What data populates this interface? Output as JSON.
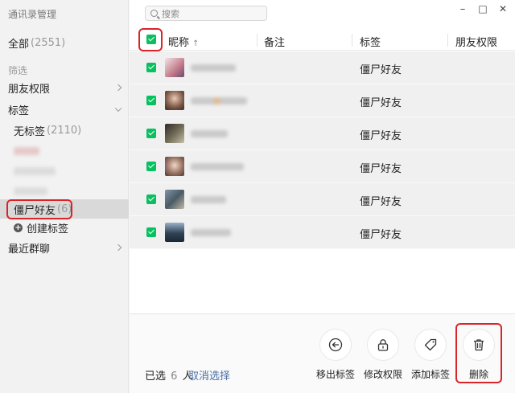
{
  "app_title": "通讯录管理",
  "sidebar": {
    "all_label": "全部",
    "all_count": "(2551)",
    "filter_label": "筛选",
    "friend_perm_label": "朋友权限",
    "tags_label": "标签",
    "untagged_label": "无标签",
    "untagged_count": "(2110)",
    "zombie_label": "僵尸好友",
    "zombie_count": "(6)",
    "create_tag_label": "创建标签",
    "recent_groups_label": "最近群聊"
  },
  "search": {
    "placeholder": "搜索"
  },
  "window_controls": {
    "minimize": "–",
    "maximize": "□",
    "close": "✕"
  },
  "table": {
    "headers": {
      "nickname": "昵称",
      "sort_arrow": "↑",
      "remark": "备注",
      "tag": "标签",
      "friend_perm": "朋友权限"
    },
    "rows": [
      {
        "tag": "僵尸好友"
      },
      {
        "tag": "僵尸好友"
      },
      {
        "tag": "僵尸好友"
      },
      {
        "tag": "僵尸好友"
      },
      {
        "tag": "僵尸好友"
      },
      {
        "tag": "僵尸好友"
      }
    ]
  },
  "bottom": {
    "selected_prefix": "已选",
    "selected_count": "6",
    "selected_suffix": "人",
    "cancel_selection": "取消选择",
    "actions": {
      "remove_tag": "移出标签",
      "change_perm": "修改权限",
      "add_tag": "添加标签",
      "delete": "删除"
    }
  },
  "colors": {
    "check_green": "#07c160",
    "highlight_red": "#d9252a",
    "link_blue": "#4a6fa5"
  }
}
